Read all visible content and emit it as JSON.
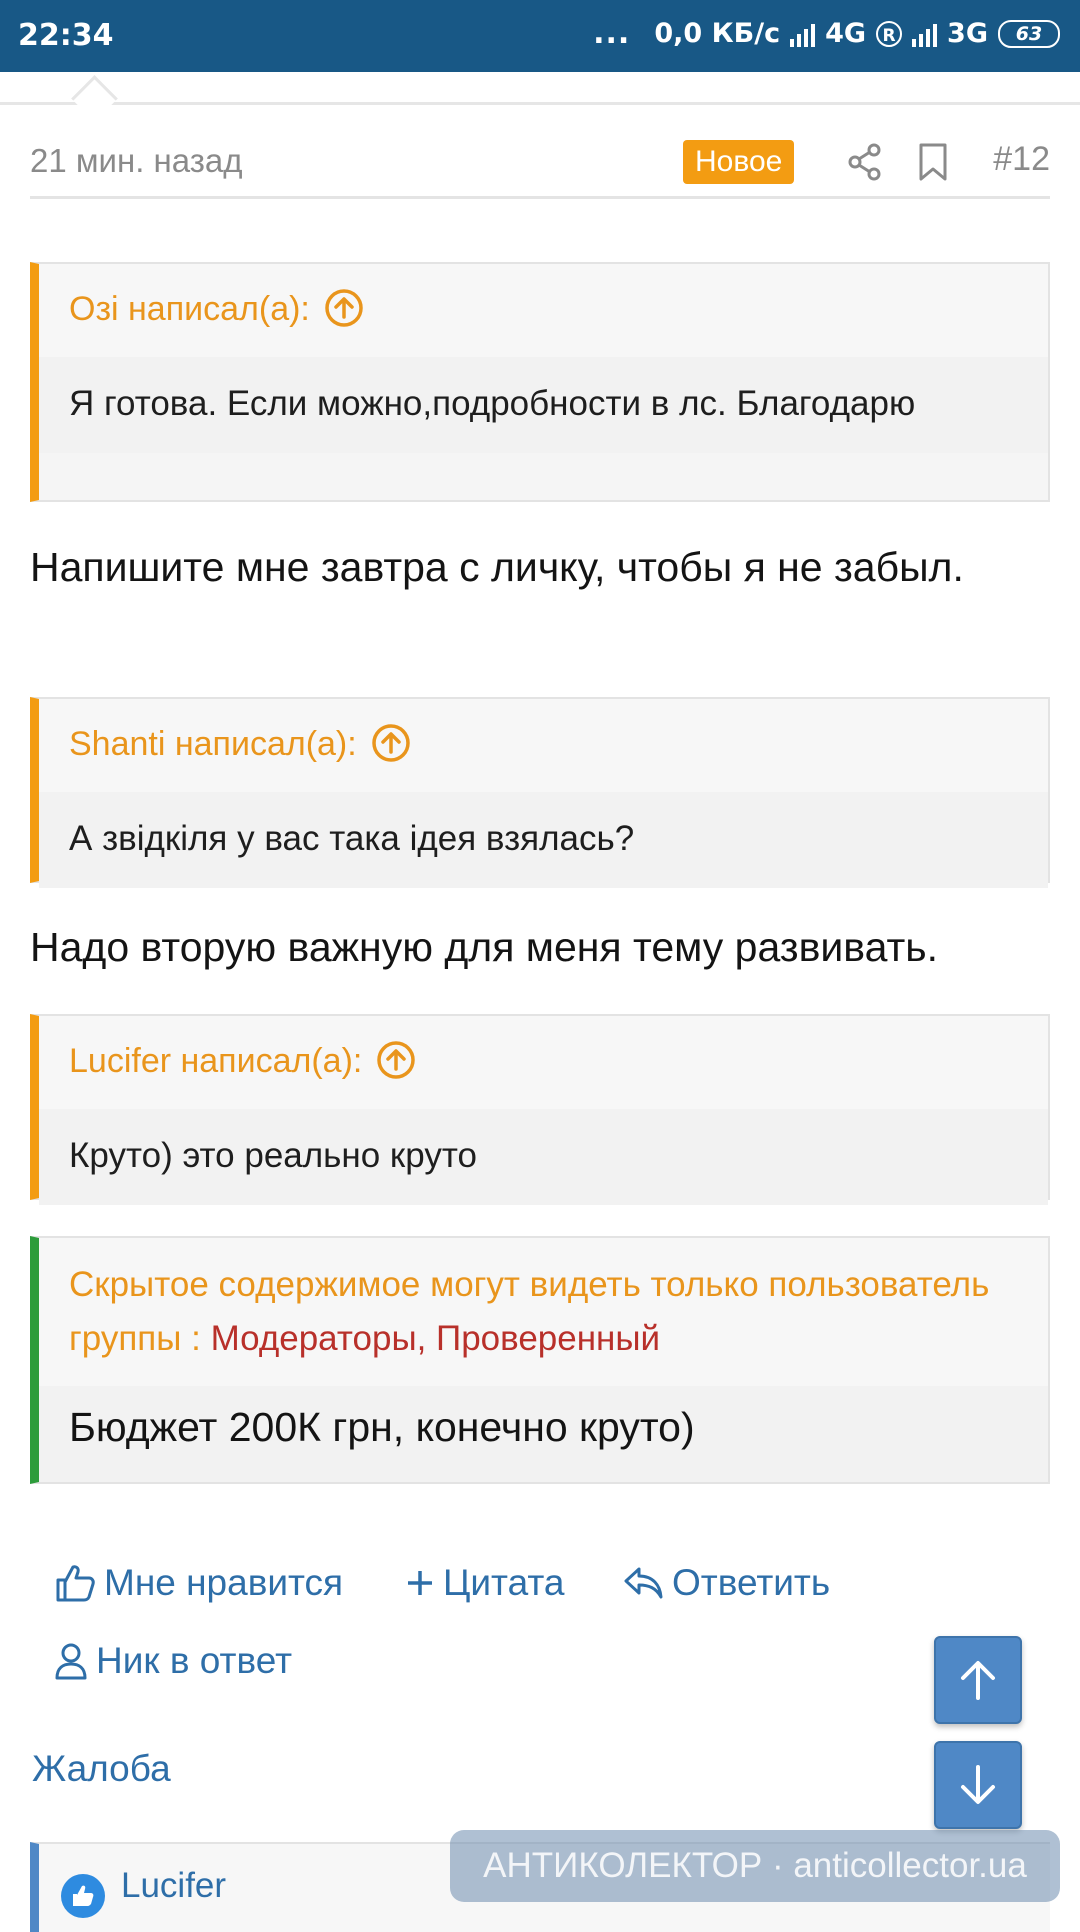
{
  "status_bar": {
    "time": "22:34",
    "dots": "...",
    "speed": "0,0 КБ/с",
    "net1": "4G",
    "roaming": "R",
    "net2": "3G",
    "battery": "63"
  },
  "post_meta": {
    "time_ago": "21 мин. назад",
    "badge": "Новое",
    "post_number": "#12"
  },
  "quotes": [
    {
      "author": "Озі написал(а):",
      "text": "Я готова. Если можно,подробности в лс. Благодарю"
    },
    {
      "author": "Shanti написал(а):",
      "text": "А звідкіля у вас така ідея взялась?"
    },
    {
      "author": "Lucifer написал(а):",
      "text": "Круто) это реально круто"
    }
  ],
  "replies": [
    "Напишите мне завтра с личку, чтобы я не забыл.",
    "Надо вторую важную для меня тему развивать."
  ],
  "hidden_content": {
    "notice": "Скрытое содержимое могут видеть только пользователь группы : ",
    "groups": "Модераторы, Проверенный",
    "text": "Бюджет 200К грн, конечно круто)"
  },
  "actions": {
    "like": "Мне нравится",
    "quote": "Цитата",
    "reply": "Ответить",
    "nick_reply": "Ник в ответ",
    "report": "Жалоба"
  },
  "liked_by": "Lucifer",
  "watermark": "АНТИКОЛЕКТОР · anticollector.ua",
  "colors": {
    "status_bar": "#185886",
    "accent_orange": "#f39c12",
    "link_blue": "#2e6ea8",
    "hidden_border": "#2d9c3b",
    "group_red": "#b8302a"
  }
}
